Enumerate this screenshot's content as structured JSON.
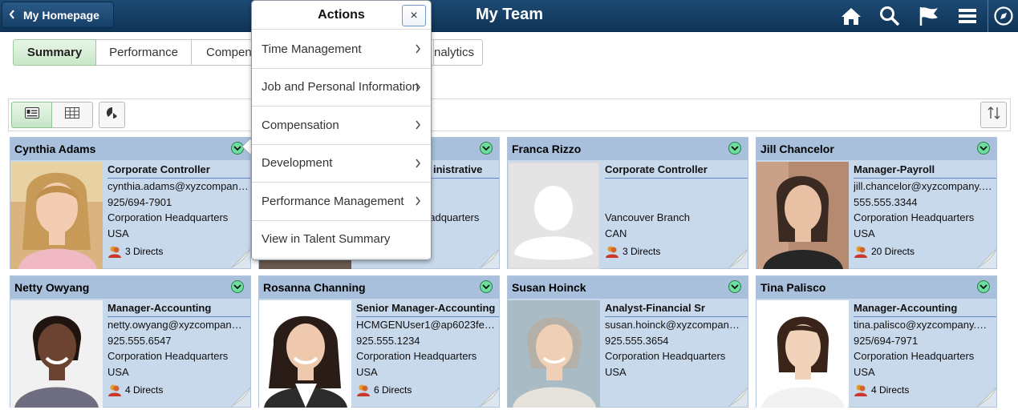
{
  "header": {
    "back_label": "My Homepage",
    "title": "My Team",
    "icons": [
      "home-icon",
      "search-icon",
      "flag-icon",
      "menu-icon",
      "compass-icon"
    ]
  },
  "tabs": [
    {
      "label": "Summary",
      "active": true
    },
    {
      "label": "Performance",
      "active": false
    },
    {
      "label": "Compen",
      "active": false
    },
    {
      "label": "",
      "active": false
    },
    {
      "label": "nalytics",
      "active": false
    }
  ],
  "toolbar": {
    "icons": [
      "card-view-icon",
      "grid-view-icon",
      "chart-icon",
      "sort-icon"
    ]
  },
  "actions_menu": {
    "title": "Actions",
    "close_label": "×",
    "items": [
      "Time Management",
      "Job and Personal Information",
      "Compensation",
      "Development",
      "Performance Management",
      "View in Talent Summary"
    ]
  },
  "cards": [
    {
      "name": "Cynthia Adams",
      "job": "Corporate Controller",
      "email": "cynthia.adams@xyzcompan…",
      "phone": "925/694-7901",
      "location": "Corporation Headquarters",
      "country": "USA",
      "directs": "3 Directs",
      "photo": "woman-blonde"
    },
    {
      "name": "",
      "job": "inistrative",
      "email": "",
      "phone": "",
      "location": "eadquarters",
      "country": "",
      "directs": "",
      "photo": "hidden"
    },
    {
      "name": "Franca Rizzo",
      "job": "Corporate Controller",
      "email": "",
      "phone": "",
      "location": "Vancouver Branch",
      "country": "CAN",
      "directs": "3 Directs",
      "photo": "placeholder"
    },
    {
      "name": "Jill Chancelor",
      "job": "Manager-Payroll",
      "email": "jill.chancelor@xyzcompany.…",
      "phone": "555.555.3344",
      "location": "Corporation Headquarters",
      "country": "USA",
      "directs": "20 Directs",
      "photo": "woman-dark"
    },
    {
      "name": "Netty Owyang",
      "job": "Manager-Accounting",
      "email": "netty.owyang@xyzcompan…",
      "phone": "925.555.6547",
      "location": "Corporation Headquarters",
      "country": "USA",
      "directs": "4 Directs",
      "photo": "woman-smile"
    },
    {
      "name": "Rosanna Channing",
      "job": "Senior Manager-Accounting",
      "email": "HCMGENUser1@ap6023fe…",
      "phone": "925.555.1234",
      "location": "Corporation Headquarters",
      "country": "USA",
      "directs": "6 Directs",
      "photo": "woman-brunette"
    },
    {
      "name": "Susan Hoinck",
      "job": "Analyst-Financial Sr",
      "email": "susan.hoinck@xyzcompan…",
      "phone": "925.555.3654",
      "location": "Corporation Headquarters",
      "country": "USA",
      "directs": "",
      "photo": "woman-grey"
    },
    {
      "name": "Tina Palisco",
      "job": "Manager-Accounting",
      "email": "tina.palisco@xyzcompany.…",
      "phone": "925/694-7971",
      "location": "Corporation Headquarters",
      "country": "USA",
      "directs": "4 Directs",
      "photo": "woman-asian"
    }
  ]
}
